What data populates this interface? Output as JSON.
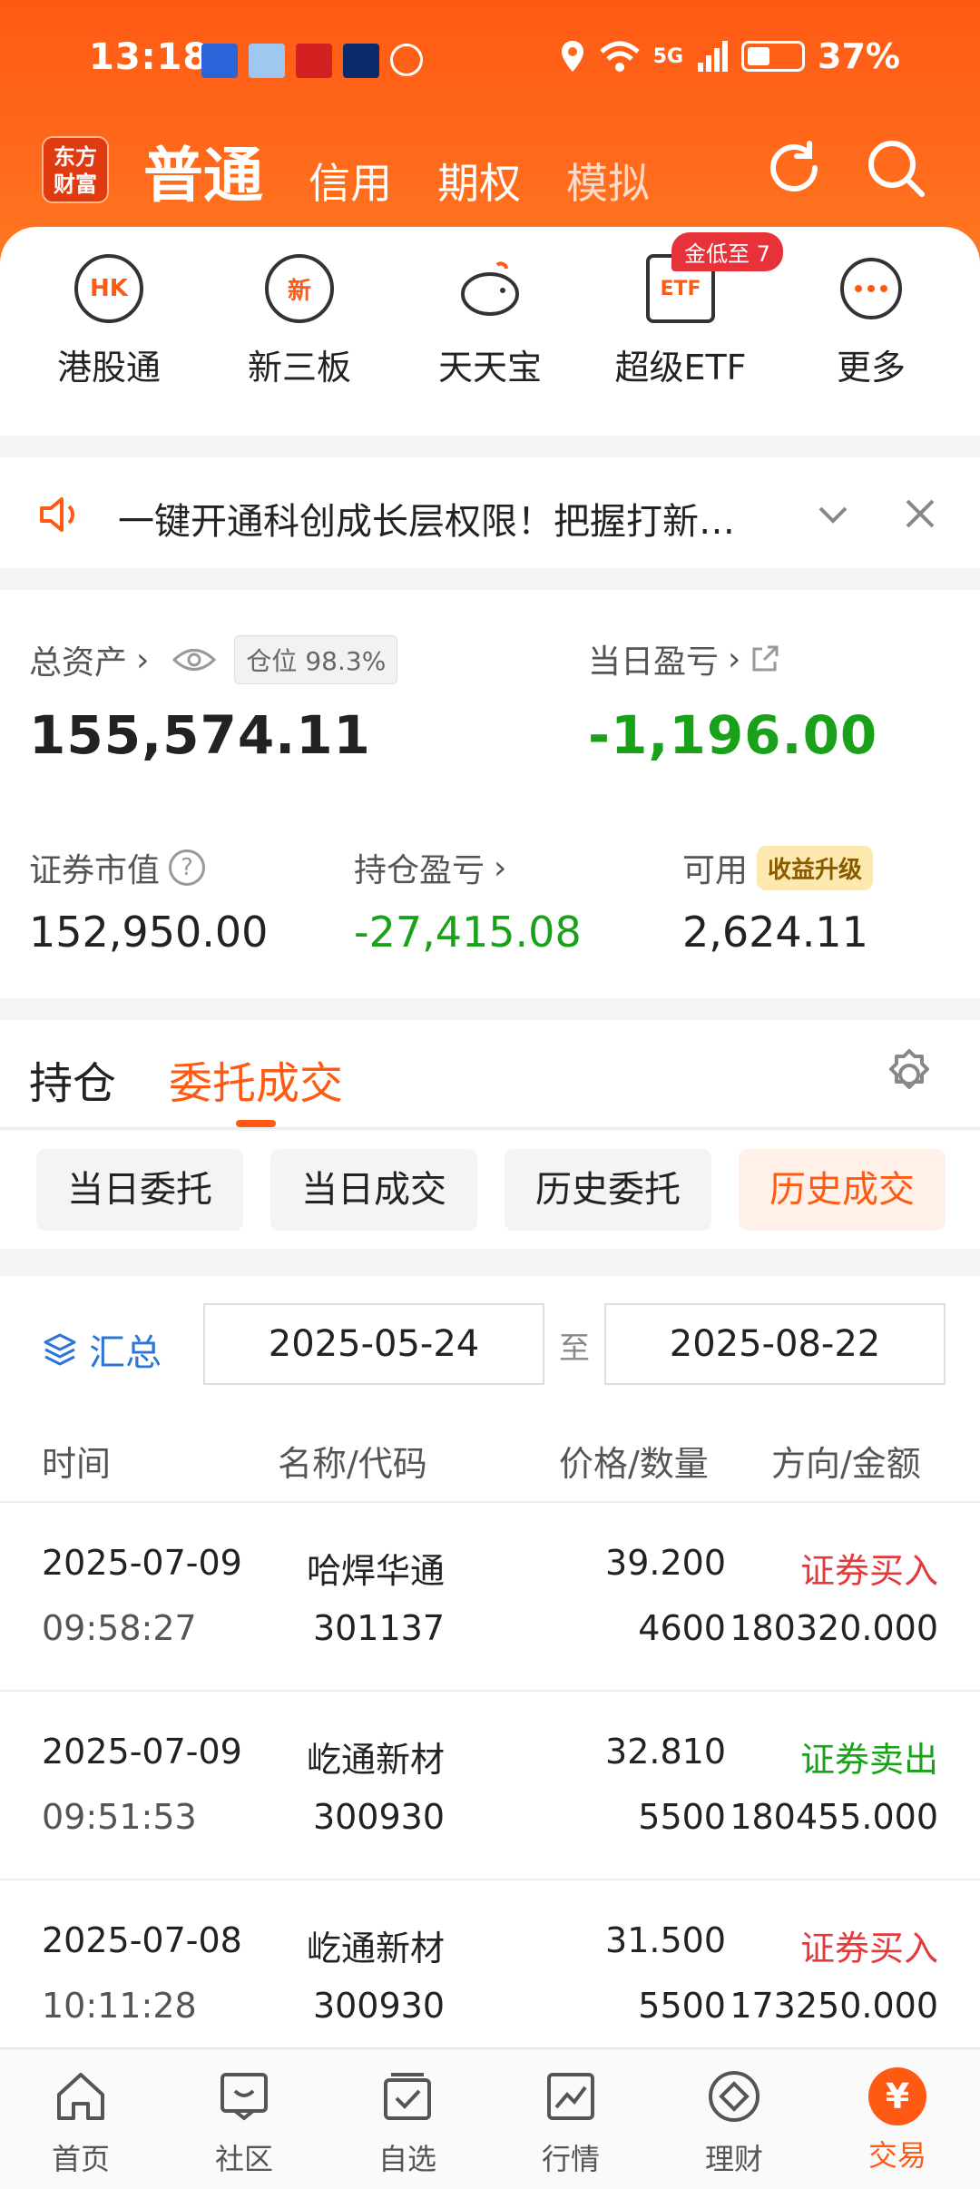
{
  "status_bar": {
    "time": "13:18",
    "battery": "37%",
    "network": "5G"
  },
  "header": {
    "logo": "东方财富",
    "tabs": [
      {
        "label": "普通",
        "active": true
      },
      {
        "label": "信用",
        "active": false
      },
      {
        "label": "期权",
        "active": false
      },
      {
        "label": "模拟",
        "active": false
      }
    ]
  },
  "shortcuts": {
    "items": [
      {
        "label": "港股通",
        "icon": "HK"
      },
      {
        "label": "新三板",
        "icon": "新"
      },
      {
        "label": "天天宝",
        "icon": "piggy-bank-icon"
      },
      {
        "label": "超级ETF",
        "icon": "ETF"
      },
      {
        "label": "更多",
        "icon": "more-icon"
      }
    ],
    "badge": "金低至 7"
  },
  "notice": {
    "text": "一键开通科创成长层权限！把握打新…"
  },
  "assets": {
    "total_label": "总资产",
    "position_label": "仓位",
    "position_value": "98.3%",
    "total_value": "155,574.11",
    "daily_pl_label": "当日盈亏",
    "daily_pl_value": "-1,196.00",
    "market_value_label": "证券市值",
    "market_value": "152,950.00",
    "holding_pl_label": "持仓盈亏",
    "holding_pl_value": "-27,415.08",
    "available_label": "可用",
    "available_value": "2,624.11",
    "upgrade_chip": "收益升级"
  },
  "section_tabs": {
    "holdings": "持仓",
    "orders": "委托成交"
  },
  "subtabs": [
    "当日委托",
    "当日成交",
    "历史委托",
    "历史成交"
  ],
  "filter": {
    "summary": "汇总",
    "start_date": "2025-05-24",
    "to": "至",
    "end_date": "2025-08-22"
  },
  "table": {
    "headers": [
      "时间",
      "名称/代码",
      "价格/数量",
      "方向/金额"
    ],
    "rows": [
      {
        "date": "2025-07-09",
        "time": "09:58:27",
        "name": "哈焊华通",
        "code": "301137",
        "price": "39.200",
        "qty": "4600",
        "direction": "证券买入",
        "amount": "180320.000",
        "side": "buy"
      },
      {
        "date": "2025-07-09",
        "time": "09:51:53",
        "name": "屹通新材",
        "code": "300930",
        "price": "32.810",
        "qty": "5500",
        "direction": "证券卖出",
        "amount": "180455.000",
        "side": "sell"
      },
      {
        "date": "2025-07-08",
        "time": "10:11:28",
        "name": "屹通新材",
        "code": "300930",
        "price": "31.500",
        "qty": "5500",
        "direction": "证券买入",
        "amount": "173250.000",
        "side": "buy"
      }
    ]
  },
  "bottom_nav": [
    {
      "label": "首页"
    },
    {
      "label": "社区"
    },
    {
      "label": "自选"
    },
    {
      "label": "行情"
    },
    {
      "label": "理财"
    },
    {
      "label": "交易",
      "active": true,
      "icon_text": "¥"
    }
  ],
  "colors": {
    "accent": "#ff5a14",
    "gain": "#e33b3b",
    "loss": "#1aa11a",
    "link": "#2b76d6"
  }
}
